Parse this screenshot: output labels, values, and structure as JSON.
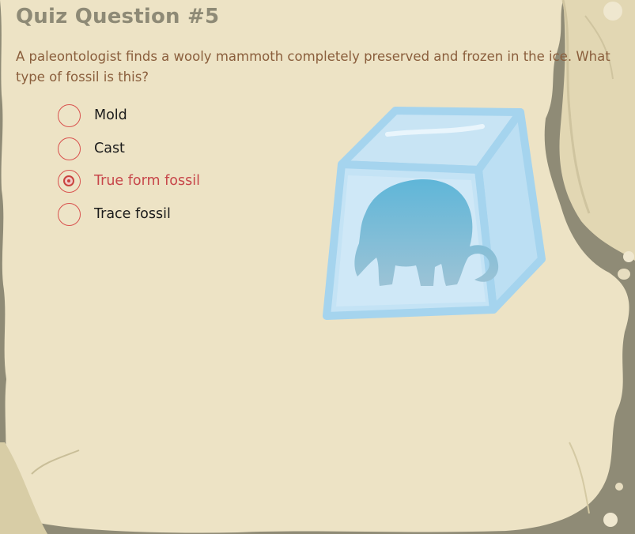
{
  "quiz": {
    "title": "Quiz Question #5",
    "question": "A paleontologist finds a wooly mammoth completely preserved and frozen in the ice. What type of fossil is this?",
    "options": [
      {
        "label": "Mold",
        "selected": false
      },
      {
        "label": "Cast",
        "selected": false
      },
      {
        "label": "True form fossil",
        "selected": true
      },
      {
        "label": "Trace fossil",
        "selected": false
      }
    ]
  },
  "illustration": {
    "subject": "mammoth-in-ice-cube"
  },
  "colors": {
    "background_rock": "#8f8b76",
    "paper": "#ede3c5",
    "title": "#8e8a76",
    "question_text": "#8a5e3c",
    "radio_border": "#d9534f",
    "selected_label": "#c7464a",
    "ice_edge": "#a8d6ee",
    "mammoth": "#7fb8d4"
  }
}
